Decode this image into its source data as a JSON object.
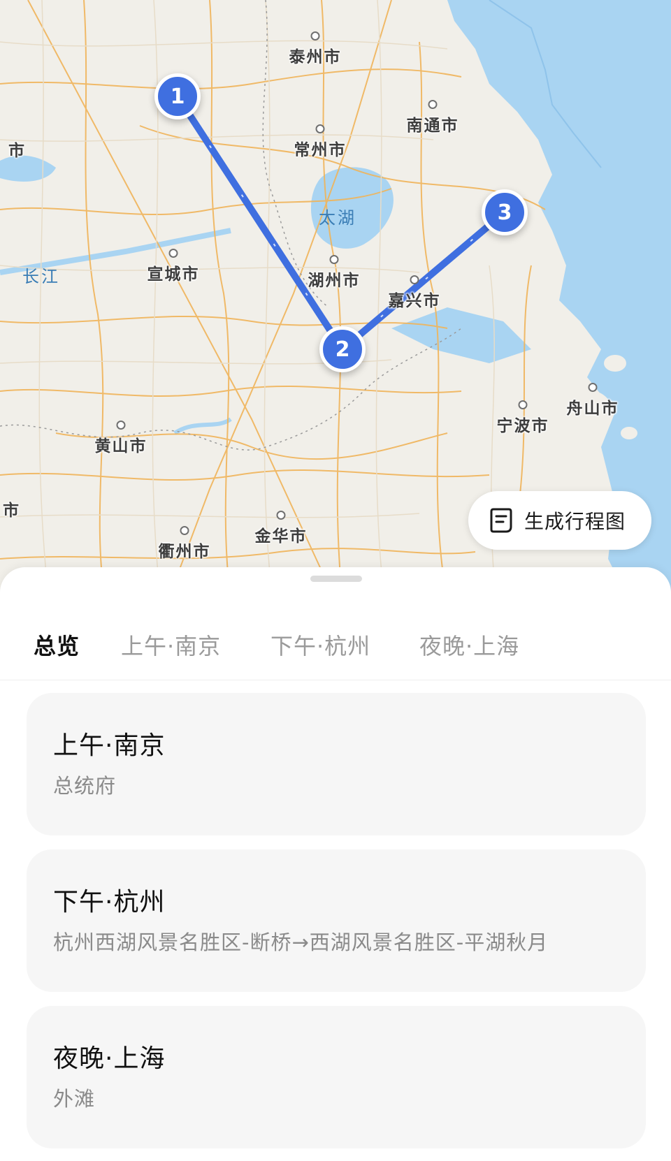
{
  "map": {
    "cities": [
      {
        "name": "泰州市"
      },
      {
        "name": "南通市"
      },
      {
        "name": "常州市"
      },
      {
        "name": "宣城市"
      },
      {
        "name": "湖州市"
      },
      {
        "name": "嘉兴市"
      },
      {
        "name": "舟山市"
      },
      {
        "name": "宁波市"
      },
      {
        "name": "黄山市"
      },
      {
        "name": "金华市"
      },
      {
        "name": "衢州市"
      }
    ],
    "edge_labels": [
      "市",
      "市"
    ],
    "water": {
      "taihu": "太湖",
      "changjiang": "长江"
    },
    "markers": [
      "1",
      "2",
      "3"
    ],
    "route_color": "#3f6fe0",
    "sea_color": "#a9d4f2"
  },
  "actions": {
    "generate_itinerary": "生成行程图"
  },
  "tabs": [
    "总览",
    "上午·南京",
    "下午·杭州",
    "夜晚·上海"
  ],
  "accent_color": "#14b36b",
  "cards": [
    {
      "title": "上午·南京",
      "detail": "总统府"
    },
    {
      "title": "下午·杭州",
      "detail": "杭州西湖风景名胜区-断桥→西湖风景名胜区-平湖秋月"
    },
    {
      "title": "夜晚·上海",
      "detail": "外滩"
    }
  ]
}
